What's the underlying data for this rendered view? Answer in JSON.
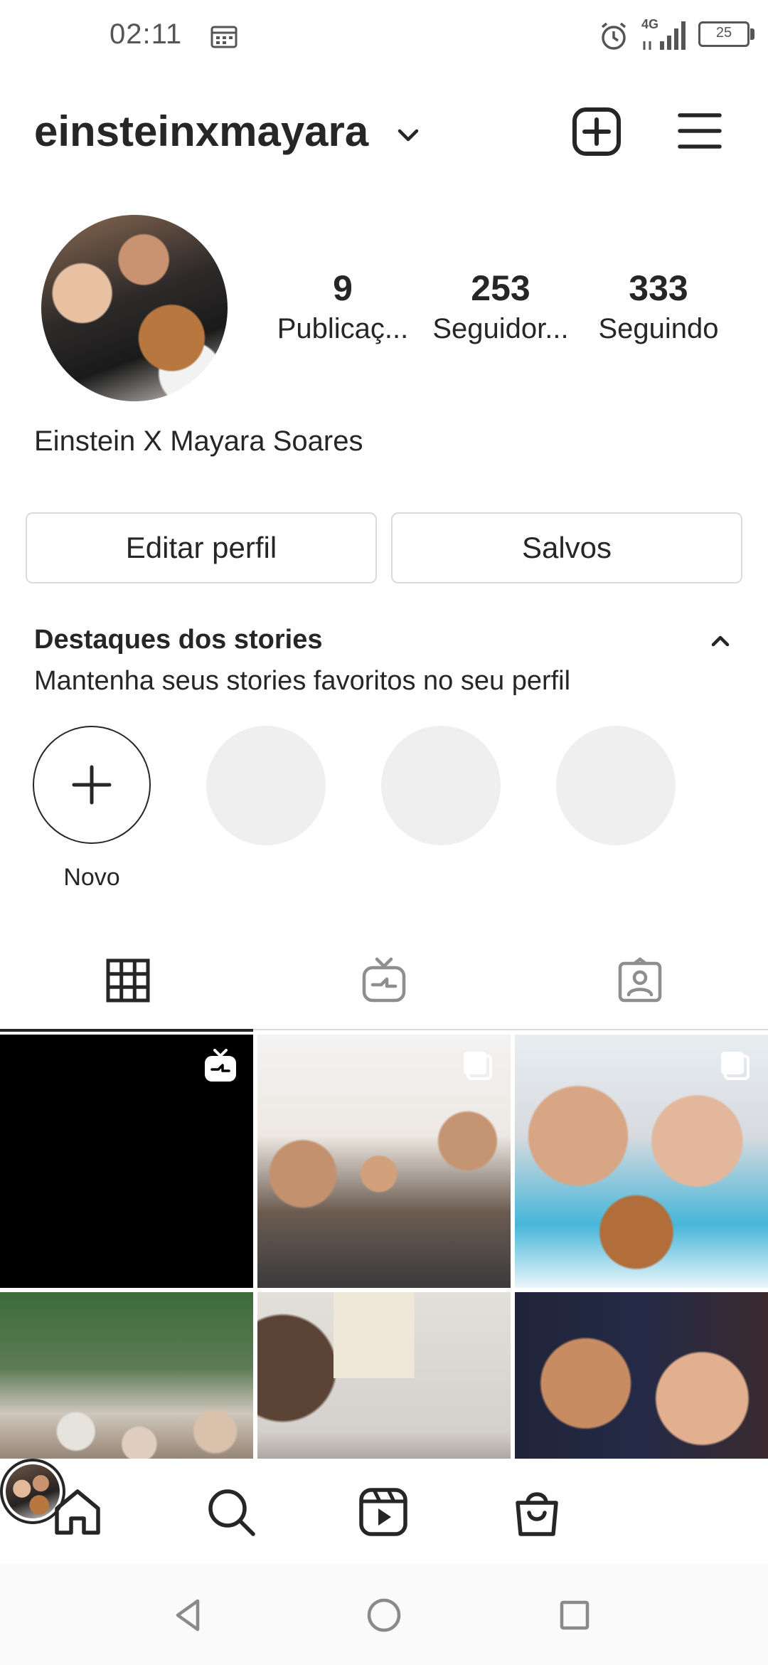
{
  "status_bar": {
    "time": "02:11",
    "network": "4G",
    "battery": "25"
  },
  "header": {
    "username": "einsteinxmayara"
  },
  "profile": {
    "display_name": "Einstein X Mayara Soares",
    "stats": {
      "posts_count": "9",
      "posts_label": "Publicaç...",
      "followers_count": "253",
      "followers_label": "Seguidor...",
      "following_count": "333",
      "following_label": "Seguindo"
    }
  },
  "buttons": {
    "edit_profile": "Editar perfil",
    "saved": "Salvos"
  },
  "highlights": {
    "title": "Destaques dos stories",
    "subtitle": "Mantenha seus stories favoritos no seu perfil",
    "new_label": "Novo"
  },
  "tabs": [
    {
      "icon": "grid-icon",
      "active": true
    },
    {
      "icon": "igtv-icon",
      "active": false
    },
    {
      "icon": "tagged-icon",
      "active": false
    }
  ],
  "posts": [
    {
      "badge": "igtv-icon"
    },
    {
      "badge": "carousel-icon"
    },
    {
      "badge": "carousel-icon"
    },
    {
      "badge": null
    },
    {
      "badge": null
    },
    {
      "badge": null
    }
  ],
  "bottom_nav": [
    "home-icon",
    "search-icon",
    "reels-icon",
    "shop-icon",
    "profile-avatar"
  ],
  "colors": {
    "text": "#262626",
    "border": "#dbdbdb",
    "placeholder": "#efefef"
  }
}
